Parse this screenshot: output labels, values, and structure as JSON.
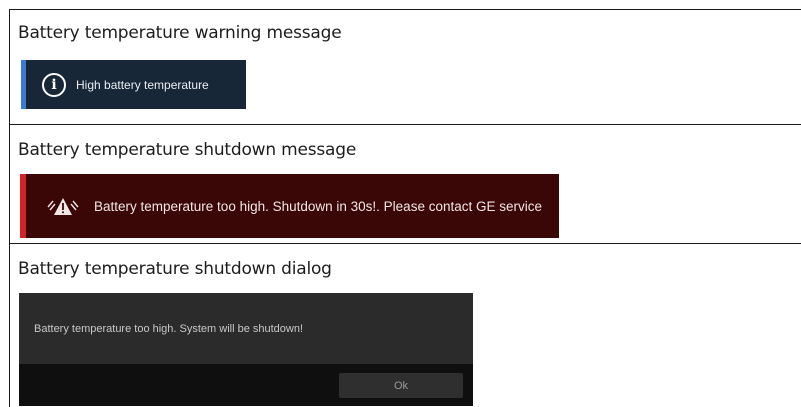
{
  "rows": [
    {
      "caption": "Battery temperature warning message",
      "toast": {
        "message": "High battery temperature",
        "icon": "info-icon",
        "stripe_color": "#3d7bd1",
        "background": "#182738"
      }
    },
    {
      "caption": "Battery temperature shutdown message",
      "toast": {
        "message": "Battery temperature too high. Shutdown in 30s!. Please contact GE service",
        "icon": "warning-triangle-icon",
        "stripe_color": "#d2232a",
        "background": "#3a0606"
      }
    },
    {
      "caption": "Battery temperature shutdown dialog",
      "dialog": {
        "message": "Battery temperature too high. System will be shutdown!",
        "ok_label": "Ok",
        "background": "#2b2b2b"
      }
    }
  ]
}
